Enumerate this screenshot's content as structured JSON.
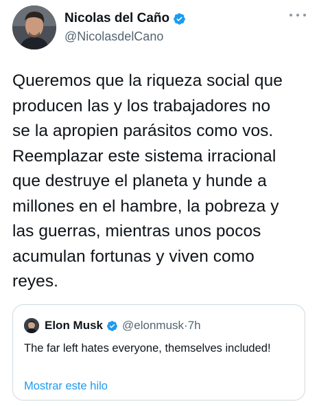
{
  "tweet": {
    "author": {
      "display_name": "Nicolas del Caño",
      "handle": "@NicolasdelCano",
      "verified": true,
      "avatar_icon": "profile-photo"
    },
    "more_icon": "more-horizontal-icon",
    "text": "Queremos que la riqueza social que\nproducen las y los trabajadores no\nse la apropien parásitos como vos.\nReemplazar este sistema irracional\nque destruye el planeta y hunde a\nmillones en el hambre, la pobreza y\nlas guerras, mientras unos pocos\nacumulan fortunas y viven como\nreyes."
  },
  "quoted_tweet": {
    "author": {
      "display_name": "Elon Musk",
      "handle": "@elonmusk",
      "separator": "·",
      "time": "7h",
      "verified": true
    },
    "text": "The far left hates everyone, themselves included!",
    "show_thread_label": "Mostrar este hilo"
  },
  "colors": {
    "text": "#0f1419",
    "secondary": "#536471",
    "accent": "#1d9bf0",
    "border": "#cfd9de"
  }
}
